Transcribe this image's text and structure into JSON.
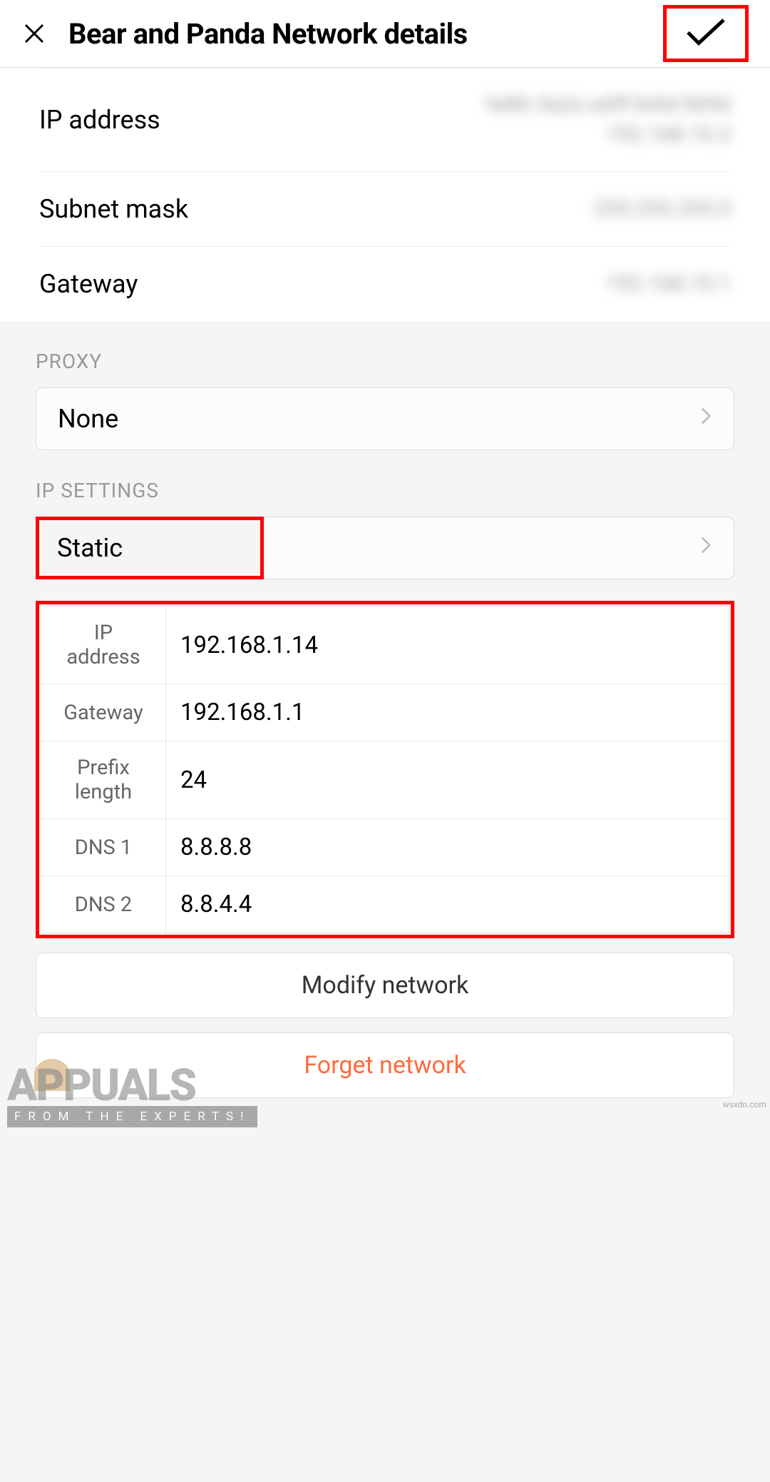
{
  "header": {
    "title": "Bear and Panda Network details"
  },
  "info": {
    "ip_label": "IP address",
    "ip_value": "fe80::0a2c:a0ff:fe9d:509d\n192.168.10.2",
    "subnet_label": "Subnet mask",
    "subnet_value": "255.255.255.0",
    "gateway_label": "Gateway",
    "gateway_value": "192.168.10.1"
  },
  "proxy": {
    "label": "PROXY",
    "value": "None"
  },
  "ip_settings": {
    "label": "IP SETTINGS",
    "value": "Static",
    "rows": [
      {
        "label": "IP address",
        "value": "192.168.1.14"
      },
      {
        "label": "Gateway",
        "value": "192.168.1.1"
      },
      {
        "label": "Prefix length",
        "value": "24"
      },
      {
        "label": "DNS 1",
        "value": "8.8.8.8"
      },
      {
        "label": "DNS 2",
        "value": "8.8.4.4"
      }
    ]
  },
  "actions": {
    "modify": "Modify network",
    "forget": "Forget network"
  },
  "watermark": {
    "title": "APPUALS",
    "subtitle": "FROM THE EXPERTS!",
    "source": "wsxdn.com"
  }
}
